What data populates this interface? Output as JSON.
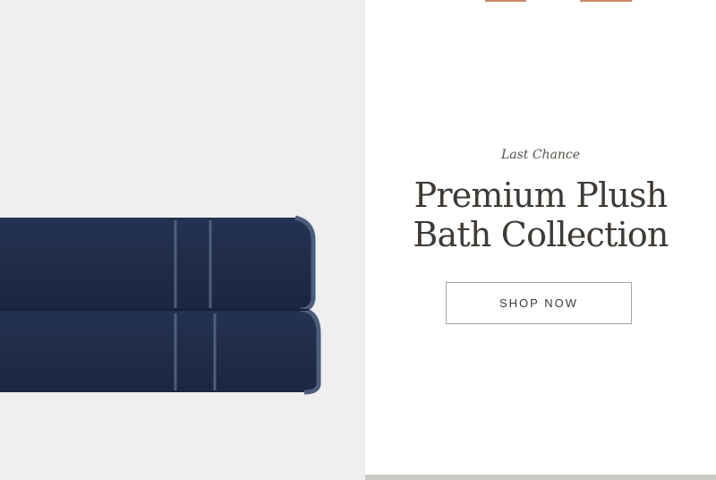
{
  "hero": {
    "eyebrow": "Last Chance",
    "headline_line1": "Premium Plush",
    "headline_line2": "Bath Collection",
    "cta_label": "SHOP NOW"
  },
  "colors": {
    "image_background": "#eeefee",
    "towel_navy": "#202d45",
    "towel_trim": "#4f5e7b",
    "text_dark": "#3f3a35",
    "accent_strip": "#c98b67"
  },
  "icons": [
    "folded-towels-image"
  ]
}
